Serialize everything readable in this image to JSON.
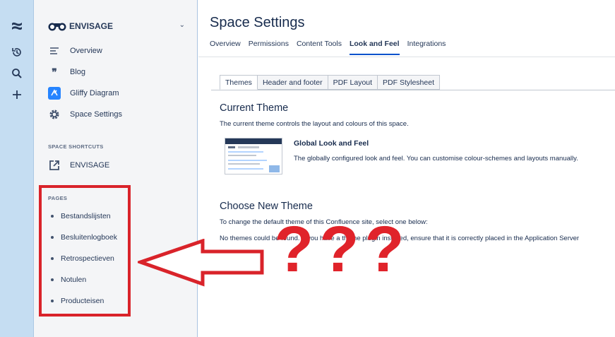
{
  "rail": {
    "icons": [
      "confluence-logo-icon",
      "recent-icon",
      "search-icon",
      "create-icon"
    ]
  },
  "sidebar": {
    "space_name": "ENVISAGE",
    "nav_items": [
      {
        "label": "Overview",
        "icon": "overview-icon"
      },
      {
        "label": "Blog",
        "icon": "blog-quote-icon"
      },
      {
        "label": "Gliffy Diagram",
        "icon": "gliffy-icon"
      },
      {
        "label": "Space Settings",
        "icon": "gear-icon"
      }
    ],
    "shortcuts_title": "SPACE SHORTCUTS",
    "shortcuts": [
      {
        "label": "ENVISAGE",
        "icon": "external-link-icon"
      }
    ],
    "pages_title": "PAGES",
    "pages": [
      "Bestandslijsten",
      "Besluitenlogboek",
      "Retrospectieven",
      "Notulen",
      "Producteisen"
    ]
  },
  "main": {
    "title": "Space Settings",
    "tabs": [
      "Overview",
      "Permissions",
      "Content Tools",
      "Look and Feel",
      "Integrations"
    ],
    "active_tab": "Look and Feel",
    "subtabs": [
      "Themes",
      "Header and footer",
      "PDF Layout",
      "PDF Stylesheet"
    ],
    "active_subtab": "Themes",
    "current_theme": {
      "heading": "Current Theme",
      "description": "The current theme controls the layout and colours of this space.",
      "theme_name": "Global Look and Feel",
      "theme_description": "The globally configured look and feel. You can customise colour-schemes and layouts manually."
    },
    "choose_theme": {
      "heading": "Choose New Theme",
      "description": "To change the default theme of this Confluence site, select one below:",
      "message": "No themes could be found. If you have a theme plugin installed, ensure that it is correctly placed in the Application Server"
    }
  },
  "overlay": {
    "question_marks": "???",
    "accent_color": "#e0232a"
  }
}
